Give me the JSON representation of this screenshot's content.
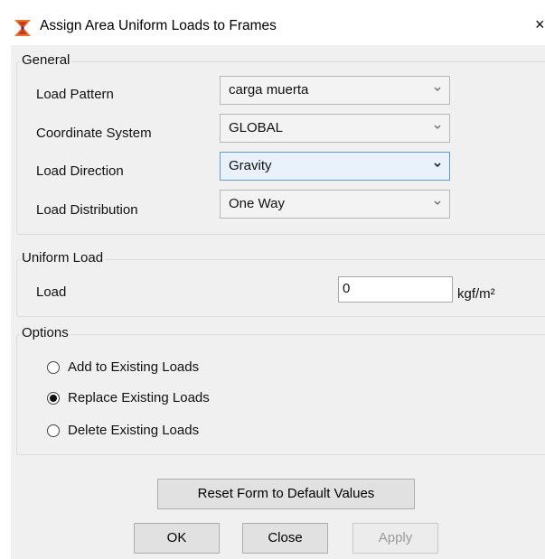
{
  "window": {
    "title": "Assign Area Uniform Loads to Frames",
    "close_glyph": "×"
  },
  "general": {
    "label": "General",
    "rows": [
      {
        "label": "Load Pattern",
        "value": "carga muerta"
      },
      {
        "label": "Coordinate System",
        "value": "GLOBAL"
      },
      {
        "label": "Load Direction",
        "value": "Gravity"
      },
      {
        "label": "Load Distribution",
        "value": "One Way"
      }
    ]
  },
  "uniform_load": {
    "label": "Uniform Load",
    "load_label": "Load",
    "load_value": "0",
    "unit": "kgf/m²"
  },
  "options": {
    "label": "Options",
    "items": [
      {
        "label": "Add to Existing Loads",
        "selected": false
      },
      {
        "label": "Replace Existing Loads",
        "selected": true
      },
      {
        "label": "Delete Existing Loads",
        "selected": false
      }
    ]
  },
  "buttons": {
    "reset": "Reset Form to Default Values",
    "ok": "OK",
    "close": "Close",
    "apply": "Apply"
  },
  "colors": {
    "accent_focus": "#5a9bd8",
    "app_icon_primary": "#e8732a",
    "app_icon_secondary": "#c23b1f"
  }
}
